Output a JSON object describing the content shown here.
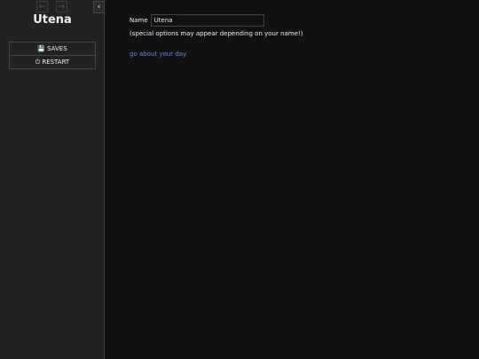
{
  "sidebar": {
    "back_icon": "←",
    "forward_icon": "→",
    "toggle_icon": "‹",
    "title": "Utena",
    "menu": [
      {
        "label": "SAVES",
        "icon": "💾"
      },
      {
        "label": "RESTART",
        "icon": "⏻"
      }
    ]
  },
  "passage": {
    "name_label": "Name",
    "name_value": "Utena",
    "hint": "(special options may appear depending on your name!)",
    "link": "go about your day"
  },
  "colors": {
    "background": "#111111",
    "sidebar": "#222222",
    "link": "#6688dd"
  }
}
